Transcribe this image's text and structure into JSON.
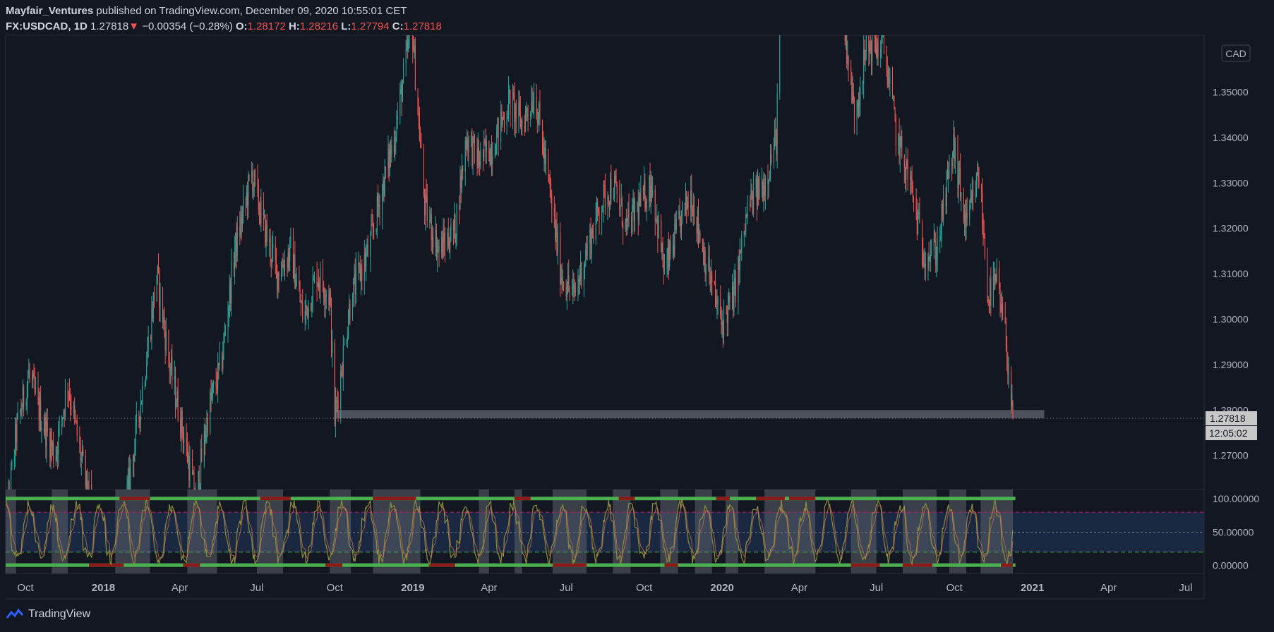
{
  "header": {
    "publisher": "Mayfair_Ventures",
    "published_text": " published on TradingView.com, December 09, 2020 10:55:01 CET",
    "symbol": "FX:USDCAD, 1D",
    "last": "1.27818",
    "arrow": "▼",
    "change": "−0.00354 (−0.28%)",
    "o_label": "O:",
    "o_val": "1.28172",
    "h_label": "H:",
    "h_val": "1.28216",
    "l_label": "L:",
    "l_val": "1.27794",
    "c_label": "C:",
    "c_val": "1.27818"
  },
  "footer": {
    "brand": "TradingView",
    "icon": "tradingview-logo-icon"
  },
  "colors": {
    "background": "#131722",
    "up": "#26a69a",
    "down": "#ef5350",
    "osc_line": "#8a8f3c",
    "osc_green": "#4caf50",
    "osc_red": "#8b1a1a",
    "band_fill": "#1c2a45",
    "price_label_bg": "#c8c8c8"
  },
  "chart_data": [
    {
      "type": "candlestick",
      "currency": "CAD",
      "ylim": [
        1.2625,
        1.3625
      ],
      "y_ticks": [
        "1.35000",
        "1.34000",
        "1.33000",
        "1.32000",
        "1.31000",
        "1.30000",
        "1.29000",
        "1.28000",
        "1.27000"
      ],
      "x_ticks": [
        "Oct",
        "2018",
        "Apr",
        "Jul",
        "Oct",
        "2019",
        "Apr",
        "Jul",
        "Oct",
        "2020",
        "Apr",
        "Jul",
        "Oct",
        "2021",
        "Apr",
        "Jul"
      ],
      "bold_x_ticks": [
        "2018",
        "2019",
        "2020",
        "2021"
      ],
      "last_price_label": "1.27818",
      "countdown_label": "12:05:02",
      "support_zone": {
        "y_low": 1.2782,
        "y_high": 1.28,
        "x_start": "2018-10-01",
        "x_end": "2021-01-15"
      },
      "approx_path": [
        [
          "2017-09-01",
          1.2415
        ],
        [
          "2017-09-20",
          1.275
        ],
        [
          "2017-10-05",
          1.288
        ],
        [
          "2017-10-20",
          1.278
        ],
        [
          "2017-11-05",
          1.27
        ],
        [
          "2017-11-20",
          1.286
        ],
        [
          "2017-12-05",
          1.27
        ],
        [
          "2017-12-20",
          1.255
        ],
        [
          "2018-01-10",
          1.238
        ],
        [
          "2018-02-01",
          1.265
        ],
        [
          "2018-02-20",
          1.29
        ],
        [
          "2018-03-05",
          1.31
        ],
        [
          "2018-03-20",
          1.29
        ],
        [
          "2018-04-05",
          1.275
        ],
        [
          "2018-04-20",
          1.26
        ],
        [
          "2018-05-05",
          1.28
        ],
        [
          "2018-05-20",
          1.29
        ],
        [
          "2018-06-05",
          1.315
        ],
        [
          "2018-06-25",
          1.332
        ],
        [
          "2018-07-10",
          1.32
        ],
        [
          "2018-07-25",
          1.31
        ],
        [
          "2018-08-10",
          1.315
        ],
        [
          "2018-08-25",
          1.3
        ],
        [
          "2018-09-10",
          1.31
        ],
        [
          "2018-09-25",
          1.305
        ],
        [
          "2018-10-01",
          1.2782
        ],
        [
          "2018-10-20",
          1.305
        ],
        [
          "2018-11-10",
          1.315
        ],
        [
          "2018-11-25",
          1.328
        ],
        [
          "2018-12-10",
          1.34
        ],
        [
          "2018-12-31",
          1.365
        ],
        [
          "2019-01-15",
          1.325
        ],
        [
          "2019-02-01",
          1.315
        ],
        [
          "2019-02-20",
          1.32
        ],
        [
          "2019-03-05",
          1.34
        ],
        [
          "2019-03-20",
          1.335
        ],
        [
          "2019-04-05",
          1.338
        ],
        [
          "2019-04-25",
          1.348
        ],
        [
          "2019-05-10",
          1.343
        ],
        [
          "2019-05-25",
          1.35
        ],
        [
          "2019-06-10",
          1.33
        ],
        [
          "2019-06-25",
          1.31
        ],
        [
          "2019-07-10",
          1.305
        ],
        [
          "2019-07-25",
          1.315
        ],
        [
          "2019-08-10",
          1.325
        ],
        [
          "2019-08-25",
          1.33
        ],
        [
          "2019-09-10",
          1.32
        ],
        [
          "2019-09-25",
          1.325
        ],
        [
          "2019-10-10",
          1.33
        ],
        [
          "2019-10-25",
          1.31
        ],
        [
          "2019-11-10",
          1.32
        ],
        [
          "2019-11-25",
          1.328
        ],
        [
          "2019-12-10",
          1.315
        ],
        [
          "2019-12-31",
          1.299
        ],
        [
          "2020-01-15",
          1.305
        ],
        [
          "2020-02-01",
          1.325
        ],
        [
          "2020-02-20",
          1.33
        ],
        [
          "2020-03-05",
          1.34
        ],
        [
          "2020-03-19",
          1.455
        ],
        [
          "2020-04-05",
          1.41
        ],
        [
          "2020-04-25",
          1.395
        ],
        [
          "2020-05-15",
          1.38
        ],
        [
          "2020-06-05",
          1.345
        ],
        [
          "2020-06-20",
          1.36
        ],
        [
          "2020-07-10",
          1.36
        ],
        [
          "2020-07-25",
          1.34
        ],
        [
          "2020-08-10",
          1.33
        ],
        [
          "2020-08-25",
          1.315
        ],
        [
          "2020-09-10",
          1.315
        ],
        [
          "2020-09-30",
          1.338
        ],
        [
          "2020-10-15",
          1.32
        ],
        [
          "2020-10-30",
          1.332
        ],
        [
          "2020-11-10",
          1.305
        ],
        [
          "2020-11-20",
          1.308
        ],
        [
          "2020-12-01",
          1.295
        ],
        [
          "2020-12-09",
          1.2782
        ]
      ]
    },
    {
      "type": "oscillator",
      "ylim": [
        -12,
        114
      ],
      "y_ticks": [
        "100.00000",
        "50.00000",
        "0.00000"
      ],
      "levels": {
        "upper": 100,
        "overbought": 80,
        "middle": 50,
        "oversold": 20,
        "lower": 0
      },
      "upper_red_blocks": [
        [
          "2018-01-20",
          "2018-02-25"
        ],
        [
          "2018-07-05",
          "2018-08-10"
        ],
        [
          "2018-11-15",
          "2019-01-05"
        ],
        [
          "2019-05-01",
          "2019-05-20"
        ],
        [
          "2019-09-01",
          "2019-09-20"
        ],
        [
          "2019-12-25",
          "2020-01-10"
        ],
        [
          "2020-02-10",
          "2020-03-15"
        ],
        [
          "2020-03-20",
          "2020-04-20"
        ]
      ],
      "lower_red_blocks": [
        [
          "2017-12-15",
          "2018-01-25"
        ],
        [
          "2018-04-05",
          "2018-04-25"
        ],
        [
          "2018-09-20",
          "2018-10-10"
        ],
        [
          "2019-01-20",
          "2019-02-20"
        ],
        [
          "2019-06-15",
          "2019-07-25"
        ],
        [
          "2019-10-25",
          "2019-11-10"
        ],
        [
          "2020-06-01",
          "2020-07-05"
        ],
        [
          "2020-08-01",
          "2020-09-05"
        ],
        [
          "2020-11-25",
          "2020-12-09"
        ]
      ],
      "gray_zones": [
        [
          "2017-09-01",
          "2017-09-20"
        ],
        [
          "2017-11-01",
          "2017-11-20"
        ],
        [
          "2018-01-15",
          "2018-02-25"
        ],
        [
          "2018-04-10",
          "2018-05-15"
        ],
        [
          "2018-07-01",
          "2018-08-01"
        ],
        [
          "2018-09-25",
          "2018-10-20"
        ],
        [
          "2018-11-15",
          "2019-01-10"
        ],
        [
          "2019-03-20",
          "2019-04-01"
        ],
        [
          "2019-05-01",
          "2019-05-10"
        ],
        [
          "2019-06-15",
          "2019-07-25"
        ],
        [
          "2019-08-25",
          "2019-09-15"
        ],
        [
          "2019-10-20",
          "2019-11-10"
        ],
        [
          "2019-11-30",
          "2019-12-20"
        ],
        [
          "2020-01-05",
          "2020-01-20"
        ],
        [
          "2020-02-20",
          "2020-04-20"
        ],
        [
          "2020-06-01",
          "2020-07-01"
        ],
        [
          "2020-08-01",
          "2020-09-10"
        ],
        [
          "2020-09-25",
          "2020-10-15"
        ],
        [
          "2020-11-01",
          "2020-12-09"
        ]
      ]
    }
  ]
}
